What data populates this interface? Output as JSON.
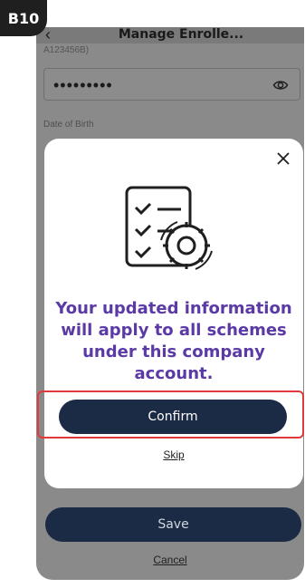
{
  "badge": {
    "label": "B10"
  },
  "header": {
    "title": "Manage Enrolle..."
  },
  "form": {
    "id_hint": "A123456B)",
    "password_value": "•••••••••",
    "dob_label": "Date of Birth"
  },
  "modal": {
    "message": "Your updated information will apply to all schemes under this company account.",
    "confirm_label": "Confirm",
    "skip_label": "Skip"
  },
  "footer": {
    "save_label": "Save",
    "cancel_label": "Cancel"
  },
  "icons": {
    "back": "chevron-left-icon",
    "eye": "eye-icon",
    "close": "close-icon",
    "illustration": "checklist-gear-icon"
  },
  "colors": {
    "accent_navy": "#1b2a45",
    "message_purple": "#5b3aa6",
    "highlight_red": "#e23a3a",
    "overlay_gray": "#8a8a8a"
  }
}
